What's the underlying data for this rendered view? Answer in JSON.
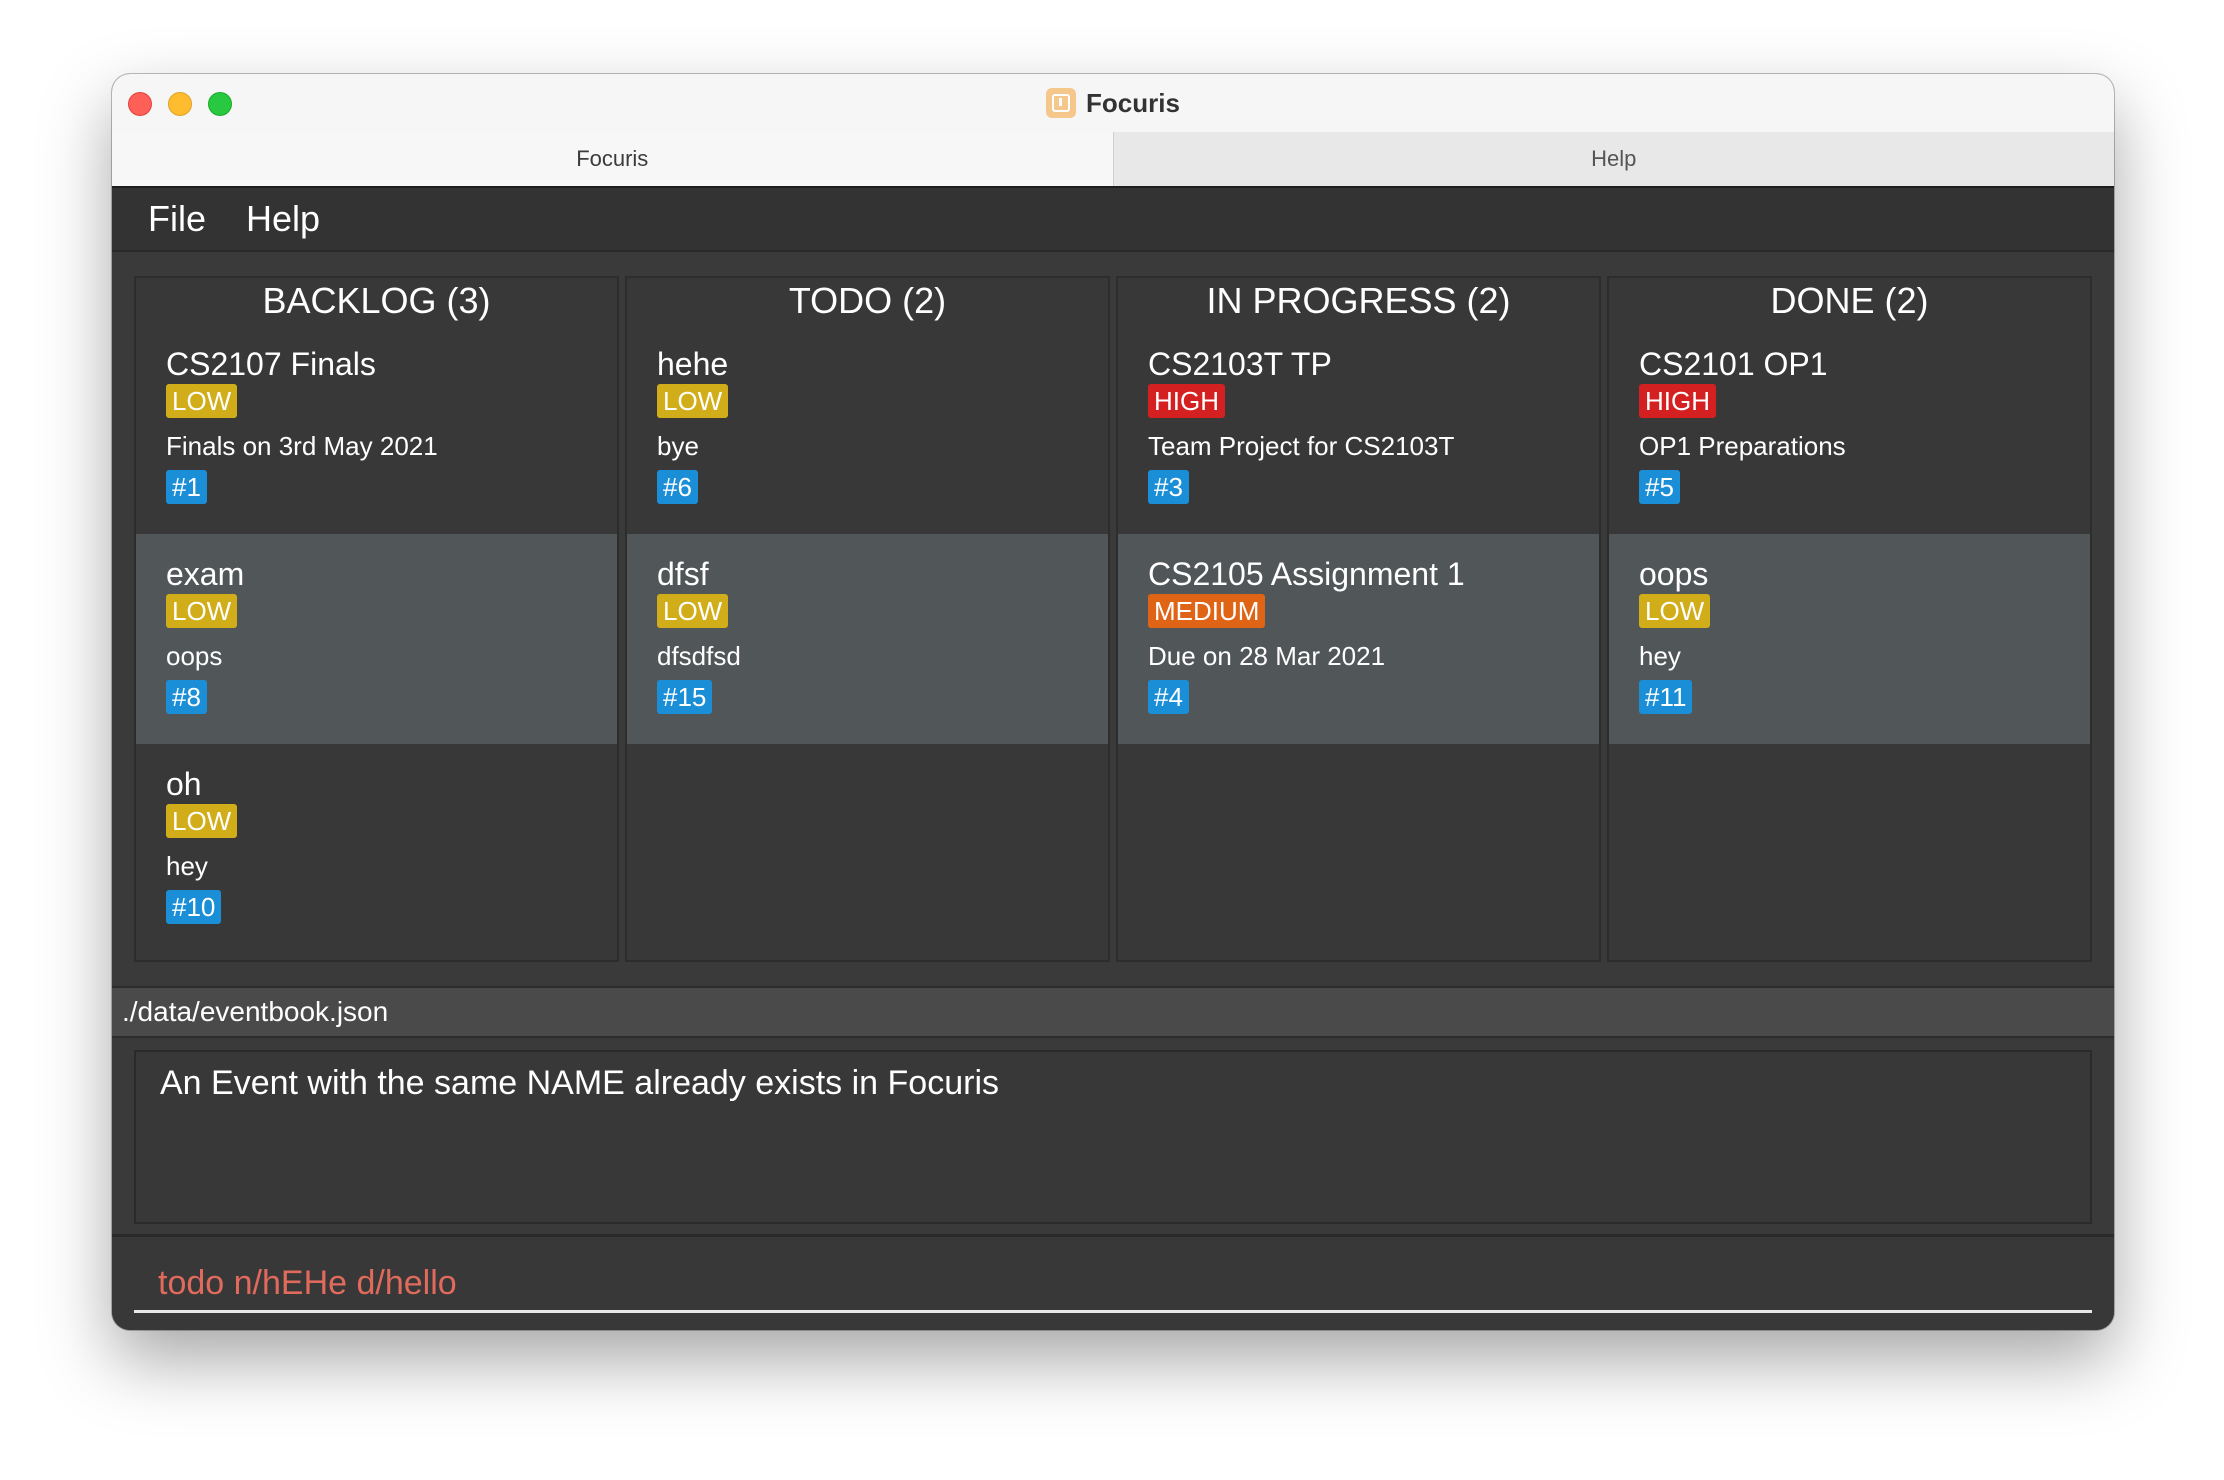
{
  "window": {
    "title": "Focuris"
  },
  "tabs": [
    {
      "label": "Focuris"
    },
    {
      "label": "Help"
    }
  ],
  "menu": [
    {
      "label": "File"
    },
    {
      "label": "Help"
    }
  ],
  "columns": [
    {
      "header": "BACKLOG (3)",
      "cards": [
        {
          "title": "CS2107 Finals",
          "priority": "LOW",
          "description": "Finals on 3rd May 2021",
          "id": "#1"
        },
        {
          "title": "exam",
          "priority": "LOW",
          "description": "oops",
          "id": "#8"
        },
        {
          "title": "oh",
          "priority": "LOW",
          "description": "hey",
          "id": "#10"
        }
      ]
    },
    {
      "header": "TODO (2)",
      "cards": [
        {
          "title": "hehe",
          "priority": "LOW",
          "description": "bye",
          "id": "#6"
        },
        {
          "title": "dfsf",
          "priority": "LOW",
          "description": "dfsdfsd",
          "id": "#15"
        }
      ]
    },
    {
      "header": "IN PROGRESS (2)",
      "cards": [
        {
          "title": "CS2103T TP",
          "priority": "HIGH",
          "description": "Team Project for CS2103T",
          "id": "#3"
        },
        {
          "title": "CS2105 Assignment 1",
          "priority": "MEDIUM",
          "description": "Due on 28 Mar 2021",
          "id": "#4"
        }
      ]
    },
    {
      "header": "DONE (2)",
      "cards": [
        {
          "title": "CS2101 OP1",
          "priority": "HIGH",
          "description": "OP1 Preparations",
          "id": "#5"
        },
        {
          "title": "oops",
          "priority": "LOW",
          "description": "hey",
          "id": "#11"
        }
      ]
    }
  ],
  "status_bar": {
    "file_path": "./data/eventbook.json"
  },
  "result": {
    "message": "An Event with the same NAME already exists in Focuris"
  },
  "command": {
    "value": "todo n/hEHe d/hello"
  },
  "colors": {
    "low": "#d1ad19",
    "high": "#d42020",
    "medium": "#e06416",
    "id": "#1b8ed8",
    "command_text": "#e06a5c"
  }
}
